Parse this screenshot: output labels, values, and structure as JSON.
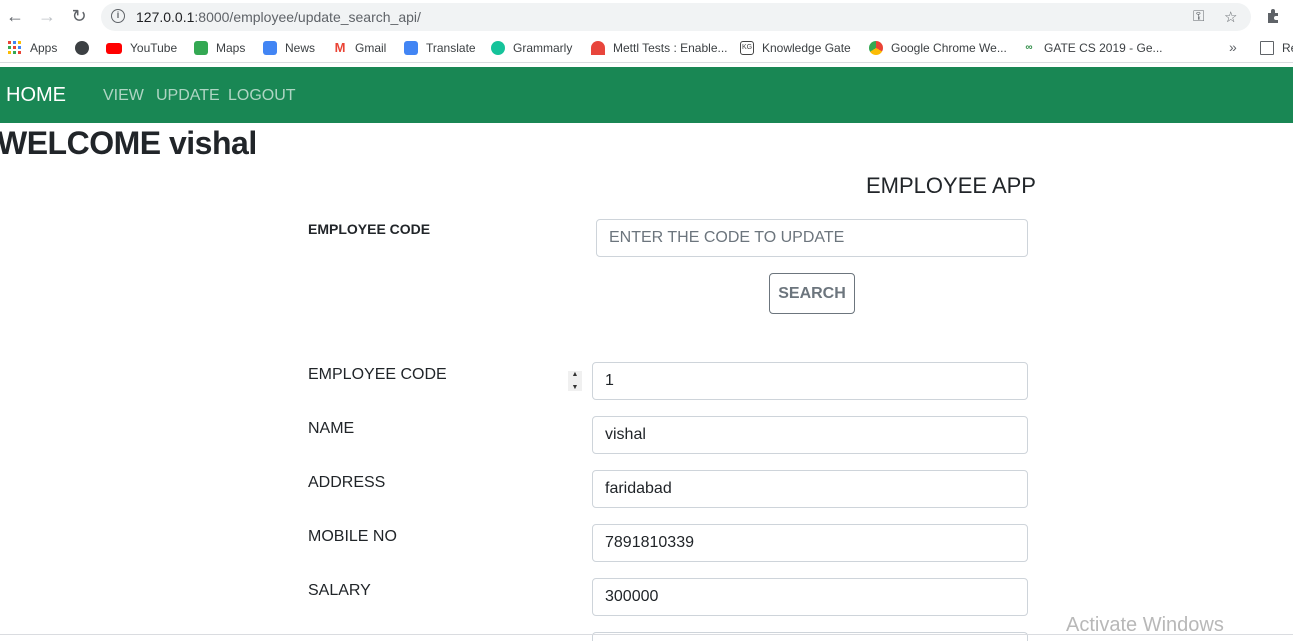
{
  "browser": {
    "url_host": "127.0.0.1",
    "url_path": ":8000/employee/update_search_api/",
    "bookmarks": [
      {
        "label": "Apps",
        "icon": "apps-grid-icon",
        "color": "#ea4335"
      },
      {
        "label": "YouTube",
        "icon": "youtube-icon",
        "color": "#ff0000"
      },
      {
        "label": "Maps",
        "icon": "maps-icon",
        "color": "#34a853"
      },
      {
        "label": "News",
        "icon": "news-icon",
        "color": "#4285f4"
      },
      {
        "label": "Gmail",
        "icon": "gmail-icon",
        "color": "#ea4335"
      },
      {
        "label": "Translate",
        "icon": "translate-icon",
        "color": "#4285f4"
      },
      {
        "label": "Grammarly",
        "icon": "grammarly-icon",
        "color": "#15c39a"
      },
      {
        "label": "Mettl Tests : Enable...",
        "icon": "mettl-icon",
        "color": "#e8453c"
      },
      {
        "label": "Knowledge Gate",
        "icon": "kg-icon",
        "color": "#444444"
      },
      {
        "label": "Google Chrome We...",
        "icon": "chrome-icon",
        "color": "#fbbc05"
      },
      {
        "label": "GATE CS 2019 - Ge...",
        "icon": "gfg-icon",
        "color": "#2f8d46"
      }
    ],
    "more_label": "»",
    "reading_list_label": "Re"
  },
  "navbar": {
    "brand": "HOME",
    "links": [
      "VIEW",
      "UPDATE",
      "LOGOUT"
    ],
    "bg_color": "#198754"
  },
  "welcome": "WELCOME vishal",
  "app_title": "EMPLOYEE APP",
  "search": {
    "label": "EMPLOYEE CODE",
    "placeholder": "ENTER THE CODE TO UPDATE",
    "button": "SEARCH"
  },
  "form": {
    "fields": [
      {
        "label": "EMPLOYEE CODE",
        "value": "1"
      },
      {
        "label": "NAME",
        "value": "vishal"
      },
      {
        "label": "ADDRESS",
        "value": "faridabad"
      },
      {
        "label": "MOBILE NO",
        "value": "7891810339"
      },
      {
        "label": "SALARY",
        "value": "300000"
      }
    ]
  },
  "watermark": "Activate Windows"
}
